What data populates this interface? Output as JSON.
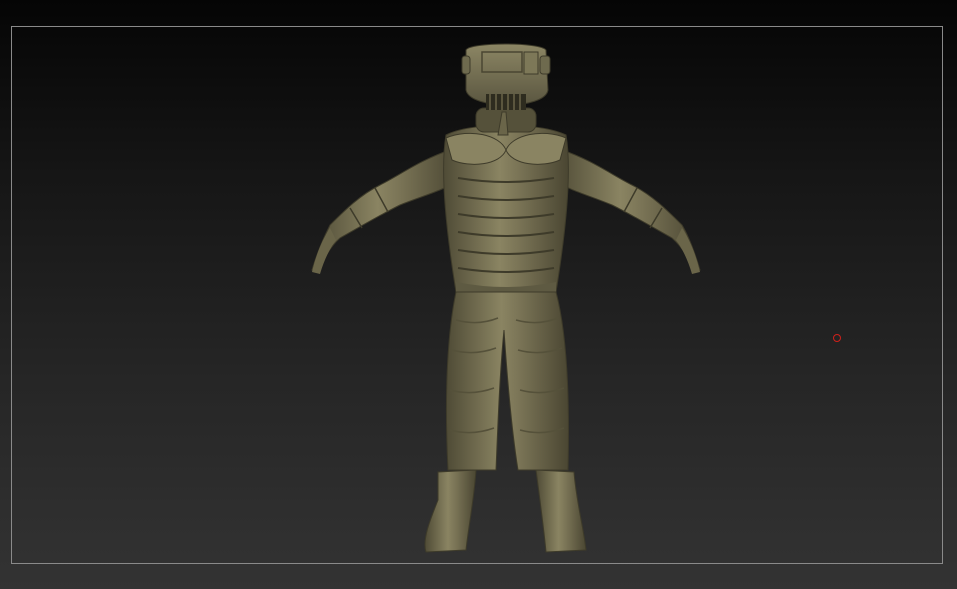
{
  "viewport": {
    "background_top": "#050505",
    "background_bottom": "#333333",
    "frame_color": "#8a8a8a"
  },
  "model": {
    "material_base": "#777152",
    "material_light": "#9a9470",
    "material_shadow": "#4a4632"
  },
  "cursor": {
    "icon": "brush-circle-icon",
    "color": "#d0201a"
  }
}
